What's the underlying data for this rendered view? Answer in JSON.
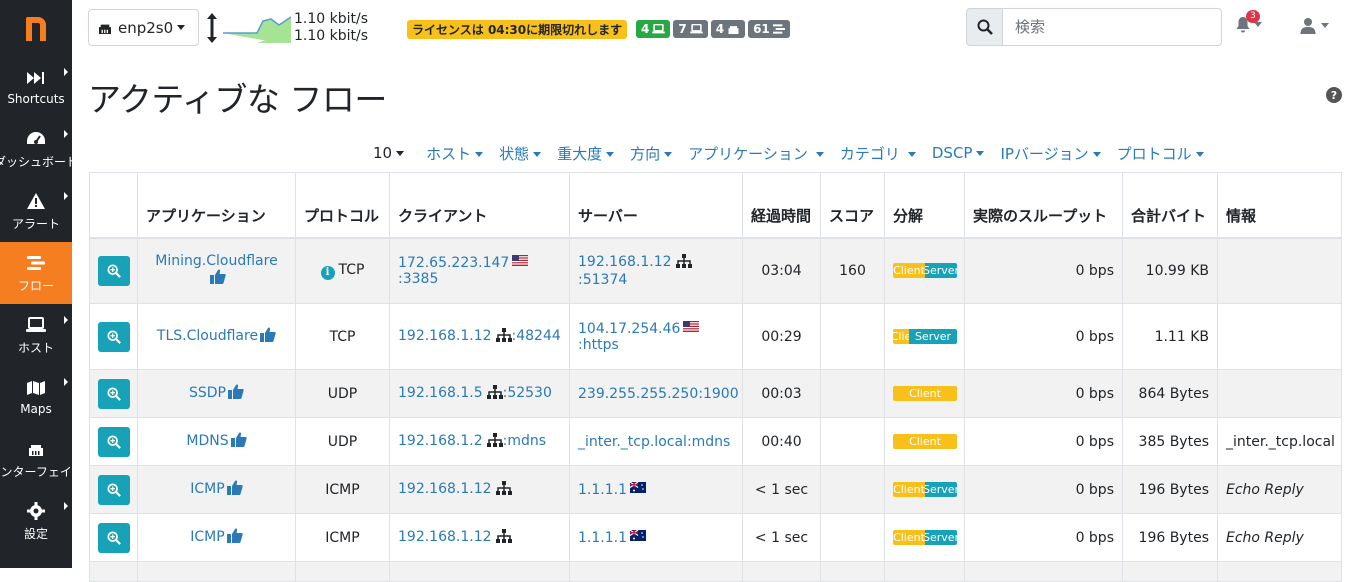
{
  "sidebar": {
    "items": [
      {
        "label": "Shortcuts",
        "icon": "fast-forward-icon"
      },
      {
        "label": "ダッシュボード",
        "icon": "gauge-icon"
      },
      {
        "label": "アラート",
        "icon": "warning-icon"
      },
      {
        "label": "フロー",
        "icon": "stream-icon"
      },
      {
        "label": "ホスト",
        "icon": "laptop-icon"
      },
      {
        "label": "Maps",
        "icon": "map-icon"
      },
      {
        "label": "インターフェイス",
        "icon": "ethernet-icon"
      },
      {
        "label": "設定",
        "icon": "gear-icon"
      }
    ]
  },
  "header": {
    "interface": "enp2s0",
    "throughput_up": "1.10 kbit/s",
    "throughput_down": "1.10 kbit/s",
    "license": "ライセンスは 04:30に期限切れします",
    "badges": [
      "4",
      "7",
      "4",
      "61"
    ],
    "search_placeholder": "検索",
    "alerts_count": "3"
  },
  "main": {
    "title": "アクティブな フロー",
    "filters": [
      "10",
      "ホスト",
      "状態",
      "重大度",
      "方向",
      "アプリケーション",
      "カテゴリ",
      "DSCP",
      "IPバージョン",
      "プロトコル"
    ],
    "columns": [
      "",
      "アプリケーション",
      "プロトコル",
      "クライアント",
      "サーバー",
      "経過時間",
      "スコア",
      "分解",
      "実際のスループット",
      "合計バイト",
      "情報"
    ],
    "breakdown_labels": {
      "client": "Client",
      "server": "Server",
      "client_short": "Clie"
    },
    "rows": [
      {
        "app": "Mining.Cloudflare",
        "proto": "TCP",
        "client_ip": "172.65.223.147",
        "client_port": ":3385",
        "server_ip": "192.168.1.12",
        "server_port": ":51374",
        "duration": "03:04",
        "score": "160",
        "throughput": "0 bps",
        "bytes": "10.99 KB",
        "info": ""
      },
      {
        "app": "TLS.Cloudflare",
        "proto": "TCP",
        "client_ip": "192.168.1.12",
        "client_port": ":48244",
        "server_ip": "104.17.254.46",
        "server_port": ":https",
        "duration": "00:29",
        "score": "",
        "throughput": "0 bps",
        "bytes": "1.11 KB",
        "info": ""
      },
      {
        "app": "SSDP",
        "proto": "UDP",
        "client_ip": "192.168.1.5",
        "client_port": ":52530",
        "server_ip": "239.255.255.250",
        "server_port": ":1900",
        "duration": "00:03",
        "score": "",
        "throughput": "0 bps",
        "bytes": "864 Bytes",
        "info": ""
      },
      {
        "app": "MDNS",
        "proto": "UDP",
        "client_ip": "192.168.1.2",
        "client_port": ":mdns",
        "server_ip": "_inter._tcp.local",
        "server_port": ":mdns",
        "duration": "00:40",
        "score": "",
        "throughput": "0 bps",
        "bytes": "385 Bytes",
        "info": "_inter._tcp.local"
      },
      {
        "app": "ICMP",
        "proto": "ICMP",
        "client_ip": "192.168.1.12",
        "client_port": "",
        "server_ip": "1.1.1.1",
        "server_port": "",
        "duration": "< 1 sec",
        "score": "",
        "throughput": "0 bps",
        "bytes": "196 Bytes",
        "info": "Echo Reply"
      },
      {
        "app": "ICMP",
        "proto": "ICMP",
        "client_ip": "192.168.1.12",
        "client_port": "",
        "server_ip": "1.1.1.1",
        "server_port": "",
        "duration": "< 1 sec",
        "score": "",
        "throughput": "0 bps",
        "bytes": "196 Bytes",
        "info": "Echo Reply"
      }
    ]
  },
  "colors": {
    "accent": "#f57e20",
    "link": "#2a7ab8",
    "teal": "#17a2b8",
    "yellow": "#f8c01a",
    "sidebar": "#212529"
  }
}
